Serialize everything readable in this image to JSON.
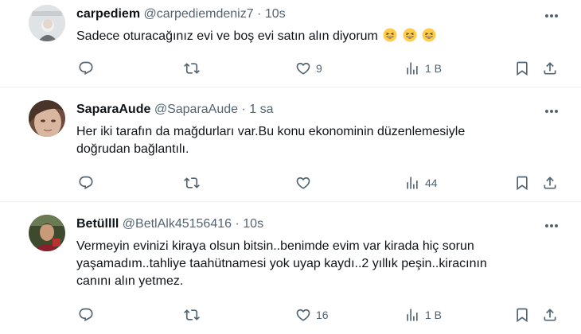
{
  "tweets": [
    {
      "name": "carpediem",
      "handle": "@carpediemdeniz7",
      "separator": "·",
      "time": "10s",
      "text": "Sadece oturacağınız evi ve  boş evi satın alın diyorum",
      "emojis": [
        "grinning-squinting-face",
        "grinning-squinting-face",
        "grinning-squinting-face"
      ],
      "likes": "9",
      "views": "1 B"
    },
    {
      "name": "SaparaAude",
      "handle": "@SaparaAude",
      "separator": "·",
      "time": "1 sa",
      "text_line1": "Her iki tarafın da mağdurları var.Bu konu ekonominin düzenlemesiyle",
      "text_line2": "doğrudan bağlantılı.",
      "views": "44"
    },
    {
      "name": "Betüllll",
      "handle": "@BetlAlk45156416",
      "separator": "·",
      "time": "10s",
      "text_line1": "Vermeyin evinizi kiraya olsun bitsin..benimde evim var kirada hiç sorun",
      "text_line2": "yaşamadım..tahliye taahütnamesi yok uyap kaydı..2 yıllık peşin..kiracının",
      "text_line3": "canını alın yetmez.",
      "likes": "16",
      "views": "1 B"
    }
  ],
  "colors": {
    "text": "#0f1419",
    "secondary": "#536471",
    "divider": "#eff3f4"
  },
  "icons": [
    "reply-icon",
    "retweet-icon",
    "like-icon",
    "views-icon",
    "bookmark-icon",
    "share-icon",
    "more-icon"
  ]
}
